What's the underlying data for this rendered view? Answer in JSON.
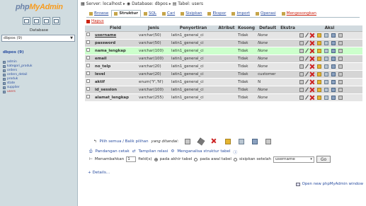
{
  "left": {
    "logo_part1": "php",
    "logo_part2": "MyAdmin",
    "database_label": "Database",
    "db_select": "dbpos (9)",
    "db_link": "dbpos (9)",
    "tables": [
      "admin",
      "kategori_produk",
      "orders",
      "orders_detail",
      "produk",
      "state",
      "supplier",
      "users"
    ],
    "active_table": "users"
  },
  "breadcrumb": {
    "server": "Server: localhost",
    "database": "Database: dbpos",
    "table": "Tabel: users"
  },
  "tabs": [
    "Browse",
    "Struktur",
    "SQL",
    "Cari",
    "Sisipkan",
    "Ekspor",
    "Import",
    "Operasi",
    "Mengosongkan"
  ],
  "tab_hapus": "Hapus",
  "table": {
    "headers": [
      "",
      "Field",
      "Jenis",
      "Penyortiran",
      "Atribut",
      "Kosong",
      "Default",
      "Ekstra",
      "Aksi"
    ],
    "rows": [
      {
        "field": "username",
        "type": "varchar(50)",
        "collation": "latin1_general_ci",
        "attr": "",
        "null": "Tidak",
        "default": "None",
        "extra": ""
      },
      {
        "field": "password",
        "type": "varchar(50)",
        "collation": "latin1_general_ci",
        "attr": "",
        "null": "Tidak",
        "default": "None",
        "extra": ""
      },
      {
        "field": "nama_lengkap",
        "type": "varchar(100)",
        "collation": "latin1_general_ci",
        "attr": "",
        "null": "Tidak",
        "default": "None",
        "extra": ""
      },
      {
        "field": "email",
        "type": "varchar(100)",
        "collation": "latin1_general_ci",
        "attr": "",
        "null": "Tidak",
        "default": "None",
        "extra": ""
      },
      {
        "field": "no_telp",
        "type": "varchar(20)",
        "collation": "latin1_general_ci",
        "attr": "",
        "null": "Tidak",
        "default": "None",
        "extra": ""
      },
      {
        "field": "level",
        "type": "varchar(20)",
        "collation": "latin1_general_ci",
        "attr": "",
        "null": "Tidak",
        "default": "customer",
        "extra": ""
      },
      {
        "field": "aktif",
        "type": "enum('Y','N')",
        "collation": "latin1_general_ci",
        "attr": "",
        "null": "Tidak",
        "default": "N",
        "extra": ""
      },
      {
        "field": "id_session",
        "type": "varchar(100)",
        "collation": "latin1_general_ci",
        "attr": "",
        "null": "Tidak",
        "default": "None",
        "extra": ""
      },
      {
        "field": "alamat_lengkap",
        "type": "varchar(255)",
        "collation": "latin1_general_ci",
        "attr": "",
        "null": "Tidak",
        "default": "None",
        "extra": ""
      }
    ],
    "highlight_row": 2
  },
  "footer": {
    "select_all": "Pilih semua / Balik pilihan",
    "with_selected": "yang ditandai:",
    "print_view": "Pandangan cetak",
    "relation_view": "Tampilan relasi",
    "analyze": "Menganalisa struktur tabel",
    "add_label": "Menambahkan",
    "add_count": "1",
    "fields_at": "field(s)",
    "at_end": "pada akhir tabel",
    "at_begin": "pada awal tabel",
    "after": "sisipkan setelah",
    "after_field": "username",
    "go": "Go",
    "details": "+ Details...",
    "new_window": "Open new phpMyAdmin window"
  }
}
